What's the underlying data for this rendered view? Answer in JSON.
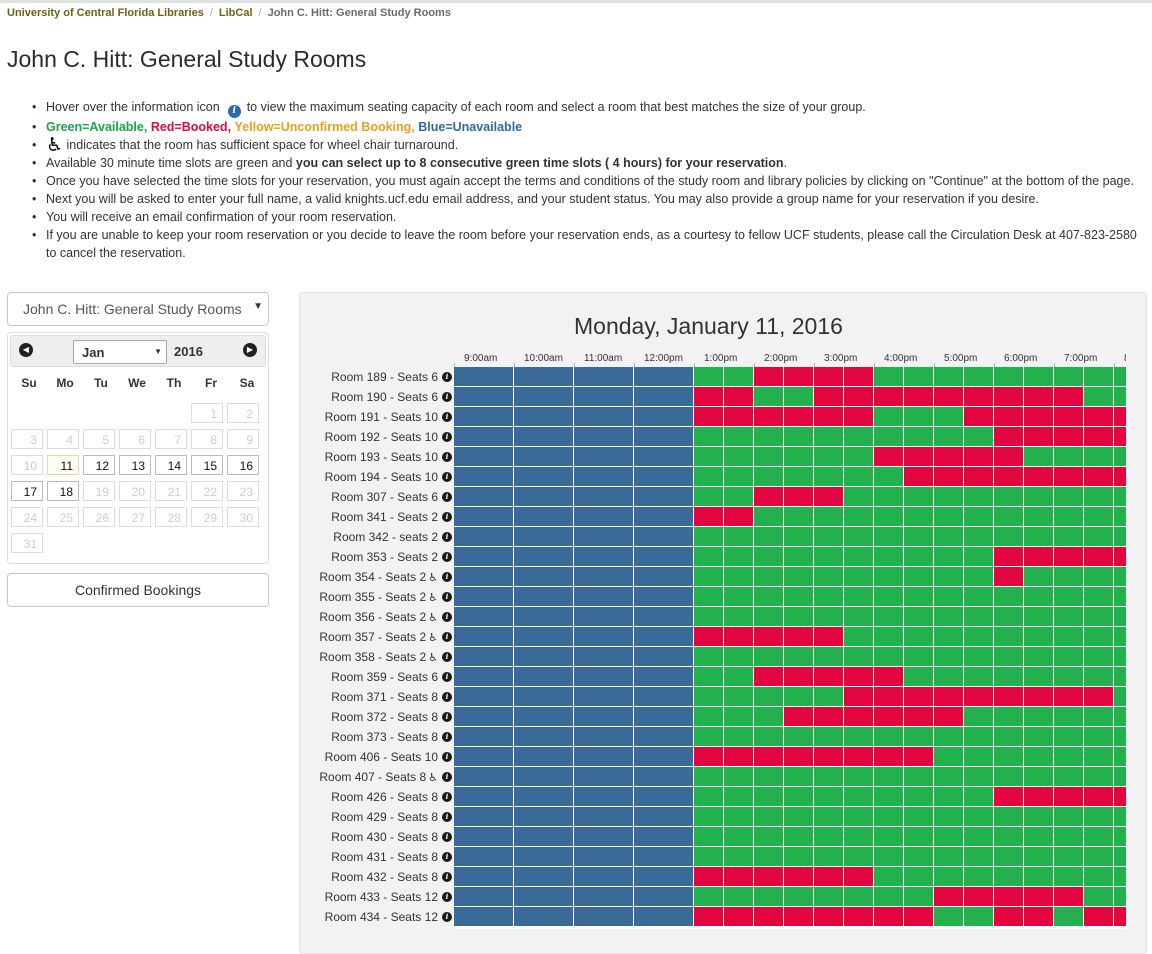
{
  "breadcrumb": {
    "items": [
      "University of Central Florida Libraries",
      "LibCal"
    ],
    "current": "John C. Hitt: General Study Rooms"
  },
  "page_title": "John C. Hitt: General Study Rooms",
  "instructions": {
    "hover_before": "Hover over the information icon",
    "hover_after": "to view the maximum seating capacity of each room and select a room that best matches the size of your group.",
    "legend_green": "Green=Available,",
    "legend_red": "Red=Booked,",
    "legend_yellow": "Yellow=Unconfirmed Booking,",
    "legend_blue": "Blue=Unavailable",
    "wheelchair": "indicates that the room has sufficient space for wheel chair turnaround.",
    "slots_prefix": "Available 30 minute time slots are green and ",
    "slots_bold": "you can select up to 8 consecutive green time slots ( 4 hours) for your reservation",
    "slots_suffix": ".",
    "continue_note": "Once you have selected the time slots for your reservation, you must again accept the terms and conditions of the study room and library policies by clicking on \"Continue\" at the bottom of the page.",
    "next_step": "Next you will be asked to enter your full name, a valid knights.ucf.edu email address, and your student status.  You may also provide a group name for your reservation if you desire.",
    "confirmation": "You will receive an email confirmation of your room reservation.",
    "cancel": "If you are unable to keep your room reservation or you decide to leave the room before your reservation ends, as a courtesy to fellow UCF students, please call the Circulation Desk at 407-823-2580 to cancel the reservation."
  },
  "room_select": {
    "value": "John C. Hitt: General Study Rooms"
  },
  "datepicker": {
    "month": "Jan",
    "year": "2016",
    "weekdays": [
      "Su",
      "Mo",
      "Tu",
      "We",
      "Th",
      "Fr",
      "Sa"
    ],
    "first_weekday": 5,
    "days_in_month": 31,
    "today": 11,
    "selectable": [
      11,
      12,
      13,
      14,
      15,
      16,
      17,
      18
    ]
  },
  "confirmed_bookings_label": "Confirmed Bookings",
  "schedule": {
    "date": "Monday, January 11, 2016",
    "times": [
      "9:00am",
      "10:00am",
      "11:00am",
      "12:00pm",
      "1:00pm",
      "2:00pm",
      "3:00pm",
      "4:00pm",
      "5:00pm",
      "6:00pm",
      "7:00pm",
      "8"
    ],
    "legend": {
      "B": "#3a6b98",
      "G": "#22b14c",
      "R": "#e3053f",
      "Y": "#f0a430"
    },
    "rooms": [
      {
        "name": "Room 189 - Seats 6",
        "wheelchair": false,
        "slots": "BBBBBBBBGGRRRRGGGGGGGGG"
      },
      {
        "name": "Room 190 - Seats 6",
        "wheelchair": false,
        "slots": "BBBBBBBBRRGGRRRRRRRRRGG"
      },
      {
        "name": "Room 191 - Seats 10",
        "wheelchair": false,
        "slots": "BBBBBBBBRRRRRRGGGRRRRRR"
      },
      {
        "name": "Room 192 - Seats 10",
        "wheelchair": false,
        "slots": "BBBBBBBBGGGGGGGGGGRRRRR"
      },
      {
        "name": "Room 193 - Seats 10",
        "wheelchair": false,
        "slots": "BBBBBBBBGGGGGGRRRRRGGGG"
      },
      {
        "name": "Room 194 - Seats 10",
        "wheelchair": false,
        "slots": "BBBBBBBBGGGGGGGRRRRRRRR"
      },
      {
        "name": "Room 307 - Seats 6",
        "wheelchair": false,
        "slots": "BBBBBBBBGGRRRGGGGGGGGGG"
      },
      {
        "name": "Room 341 - Seats 2",
        "wheelchair": false,
        "slots": "BBBBBBBBRRGGGGGGGGGGGGG"
      },
      {
        "name": "Room 342 - seats 2",
        "wheelchair": false,
        "slots": "BBBBBBBBGGGGGGGGGGGGGGG"
      },
      {
        "name": "Room 353 - Seats 2",
        "wheelchair": false,
        "slots": "BBBBBBBBGGGGGGGGGGRRRRR"
      },
      {
        "name": "Room 354 - Seats 2",
        "wheelchair": true,
        "slots": "BBBBBBBBGGGGGGGGGGRGGGG"
      },
      {
        "name": "Room 355 - Seats 2",
        "wheelchair": true,
        "slots": "BBBBBBBBGGGGGGGGGGGGGGG"
      },
      {
        "name": "Room 356 - Seats 2",
        "wheelchair": true,
        "slots": "BBBBBBBBGGGGGGGGGGGGGGG"
      },
      {
        "name": "Room 357 - Seats 2",
        "wheelchair": true,
        "slots": "BBBBBBBBRRRRRGGGGGGGGGG"
      },
      {
        "name": "Room 358 - Seats 2",
        "wheelchair": true,
        "slots": "BBBBBBBBGGGGGGGGGGGGGGG"
      },
      {
        "name": "Room 359 - Seats 6",
        "wheelchair": false,
        "slots": "BBBBBBBBGGRRRRRGGGGGGGG"
      },
      {
        "name": "Room 371 - Seats 8",
        "wheelchair": false,
        "slots": "BBBBBBBBGGGGGRRRRRRRRRG"
      },
      {
        "name": "Room 372 - Seats 8",
        "wheelchair": false,
        "slots": "BBBBBBBBGGGRRRRRRGGGGGG"
      },
      {
        "name": "Room 373 - Seats 8",
        "wheelchair": false,
        "slots": "BBBBBBBBGGGGGGGGGGGGGGG"
      },
      {
        "name": "Room 406 - Seats 10",
        "wheelchair": false,
        "slots": "BBBBBBBBRRRRRRRRGGGGGGG"
      },
      {
        "name": "Room 407 - Seats 8",
        "wheelchair": true,
        "slots": "BBBBBBBBGGGGGGGGGGGGGGG"
      },
      {
        "name": "Room 426 - Seats 8",
        "wheelchair": false,
        "slots": "BBBBBBBBGGGGGGGGGGRRRRR"
      },
      {
        "name": "Room 429 - Seats 8",
        "wheelchair": false,
        "slots": "BBBBBBBBGGGGGGGGGGGGGGG"
      },
      {
        "name": "Room 430 - Seats 8",
        "wheelchair": false,
        "slots": "BBBBBBBBGGGGGGGGGGGGGGG"
      },
      {
        "name": "Room 431 - Seats 8",
        "wheelchair": false,
        "slots": "BBBBBBBBGGGGGGGGGGGGGGG"
      },
      {
        "name": "Room 432 - Seats 8",
        "wheelchair": false,
        "slots": "BBBBBBBBRRRRRRGGGGGGGGG"
      },
      {
        "name": "Room 433 - Seats 12",
        "wheelchair": false,
        "slots": "BBBBBBBBGGGGGGGGRRRRRGG"
      },
      {
        "name": "Room 434 - Seats 12",
        "wheelchair": false,
        "slots": "BBBBBBBBRRRRRRRRGGRRGRR"
      }
    ]
  }
}
